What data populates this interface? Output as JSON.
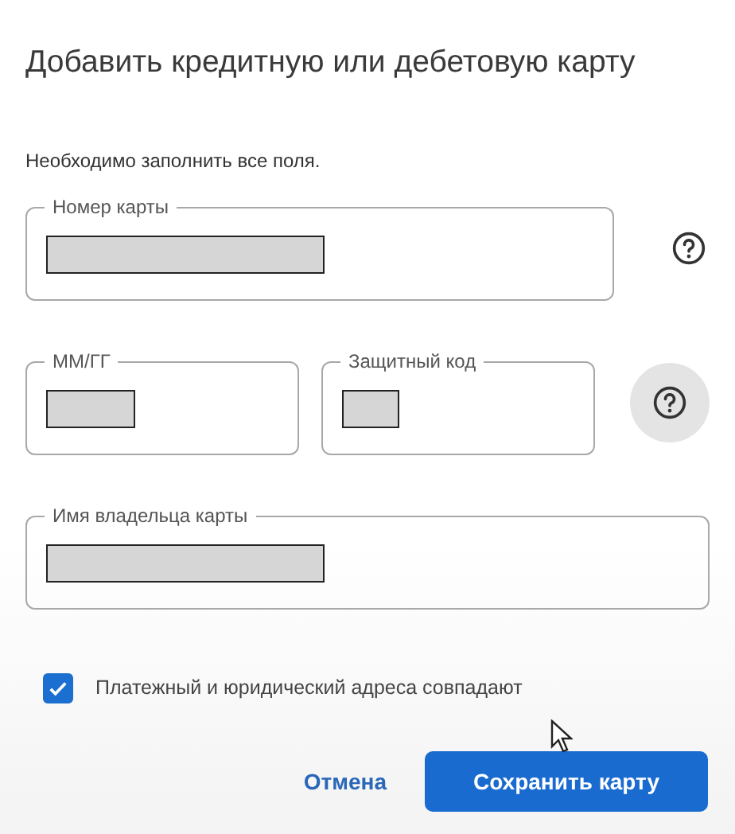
{
  "dialog": {
    "title": "Добавить кредитную или дебетовую карту",
    "note": "Необходимо заполнить все поля.",
    "fields": [
      {
        "label": "Номер карты",
        "kind": "wide",
        "help": true,
        "help_hovered": false
      },
      {
        "label": "ММ/ГГ",
        "kind": "half"
      },
      {
        "label": "Защитный код",
        "kind": "half",
        "help": true,
        "help_hovered": true
      },
      {
        "label": "Имя владельца карты",
        "kind": "full"
      }
    ],
    "checkbox": {
      "label": "Платежный и юридический адреса совпадают",
      "checked": true
    },
    "buttons": [
      {
        "label": "Отмена",
        "kind": "text"
      },
      {
        "label": "Сохранить карту",
        "kind": "primary"
      }
    ]
  }
}
